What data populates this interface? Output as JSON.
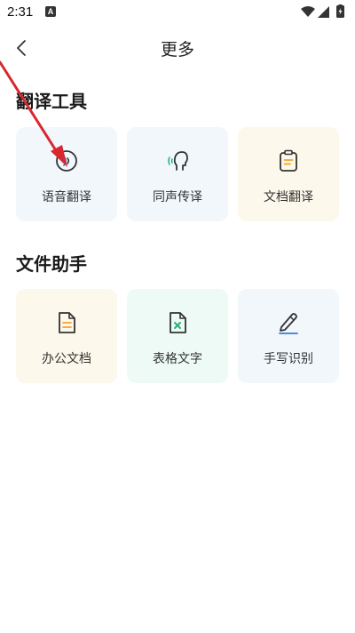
{
  "status": {
    "time": "2:31",
    "notification_glyph": "A"
  },
  "header": {
    "back_icon": "chevron-left-icon",
    "title": "更多"
  },
  "sections": [
    {
      "title": "翻译工具",
      "items": [
        {
          "label": "语音翻译",
          "icon": "voice-translate-icon",
          "bg": "#f2f7fc"
        },
        {
          "label": "同声传译",
          "icon": "simultaneous-interpretation-icon",
          "bg": "#f2f7fc"
        },
        {
          "label": "文档翻译",
          "icon": "document-translate-icon",
          "bg": "#fdf8ec"
        }
      ]
    },
    {
      "title": "文件助手",
      "items": [
        {
          "label": "办公文档",
          "icon": "office-document-icon",
          "bg": "#fdf8ec"
        },
        {
          "label": "表格文字",
          "icon": "spreadsheet-text-icon",
          "bg": "#edfaf5"
        },
        {
          "label": "手写识别",
          "icon": "handwriting-recognition-icon",
          "bg": "#f2f7fc"
        }
      ]
    }
  ],
  "colors": {
    "accent_orange": "#f0a42a",
    "accent_green": "#27b079",
    "accent_blue": "#3a7bd5",
    "annotation_red": "#d7282f"
  }
}
